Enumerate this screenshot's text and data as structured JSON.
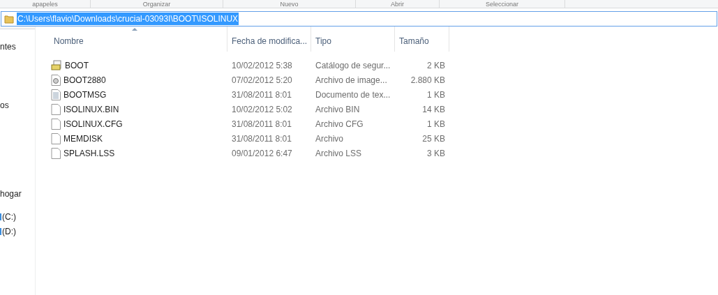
{
  "ribbon_groups": [
    "apapeles",
    "Organizar",
    "Nuevo",
    "Abrir",
    "Seleccionar"
  ],
  "address_bar": {
    "value": "C:\\Users\\flavio\\Downloads\\crucial-03093I\\BOOT\\ISOLINUX",
    "selected": true
  },
  "sidebar": {
    "items": [
      {
        "label": "ntes",
        "kind": "text"
      },
      {
        "label": "os",
        "kind": "text"
      },
      {
        "label": "hogar",
        "kind": "text"
      },
      {
        "label": "(C:)",
        "kind": "drive"
      },
      {
        "label": "(D:)",
        "kind": "drive"
      }
    ]
  },
  "table": {
    "columns": [
      {
        "label": "Nombre",
        "sorted": true
      },
      {
        "label": "Fecha de modifica...",
        "sorted": false
      },
      {
        "label": "Tipo",
        "sorted": false
      },
      {
        "label": "Tamaño",
        "sorted": false
      }
    ],
    "rows": [
      {
        "name": "BOOT",
        "date": "10/02/2012 5:38",
        "type": "Catálogo de segur...",
        "size": "2 KB",
        "kind": "catalog"
      },
      {
        "name": "BOOT2880",
        "date": "07/02/2012 5:20",
        "type": "Archivo de image...",
        "size": "2.880 KB",
        "kind": "image"
      },
      {
        "name": "BOOTMSG",
        "date": "31/08/2011 8:01",
        "type": "Documento de tex...",
        "size": "1 KB",
        "kind": "text"
      },
      {
        "name": "ISOLINUX.BIN",
        "date": "10/02/2012 5:02",
        "type": "Archivo BIN",
        "size": "14 KB",
        "kind": "file"
      },
      {
        "name": "ISOLINUX.CFG",
        "date": "31/08/2011 8:01",
        "type": "Archivo CFG",
        "size": "1 KB",
        "kind": "file"
      },
      {
        "name": "MEMDISK",
        "date": "31/08/2011 8:01",
        "type": "Archivo",
        "size": "25 KB",
        "kind": "file"
      },
      {
        "name": "SPLASH.LSS",
        "date": "09/01/2012 6:47",
        "type": "Archivo LSS",
        "size": "3 KB",
        "kind": "file"
      }
    ]
  }
}
